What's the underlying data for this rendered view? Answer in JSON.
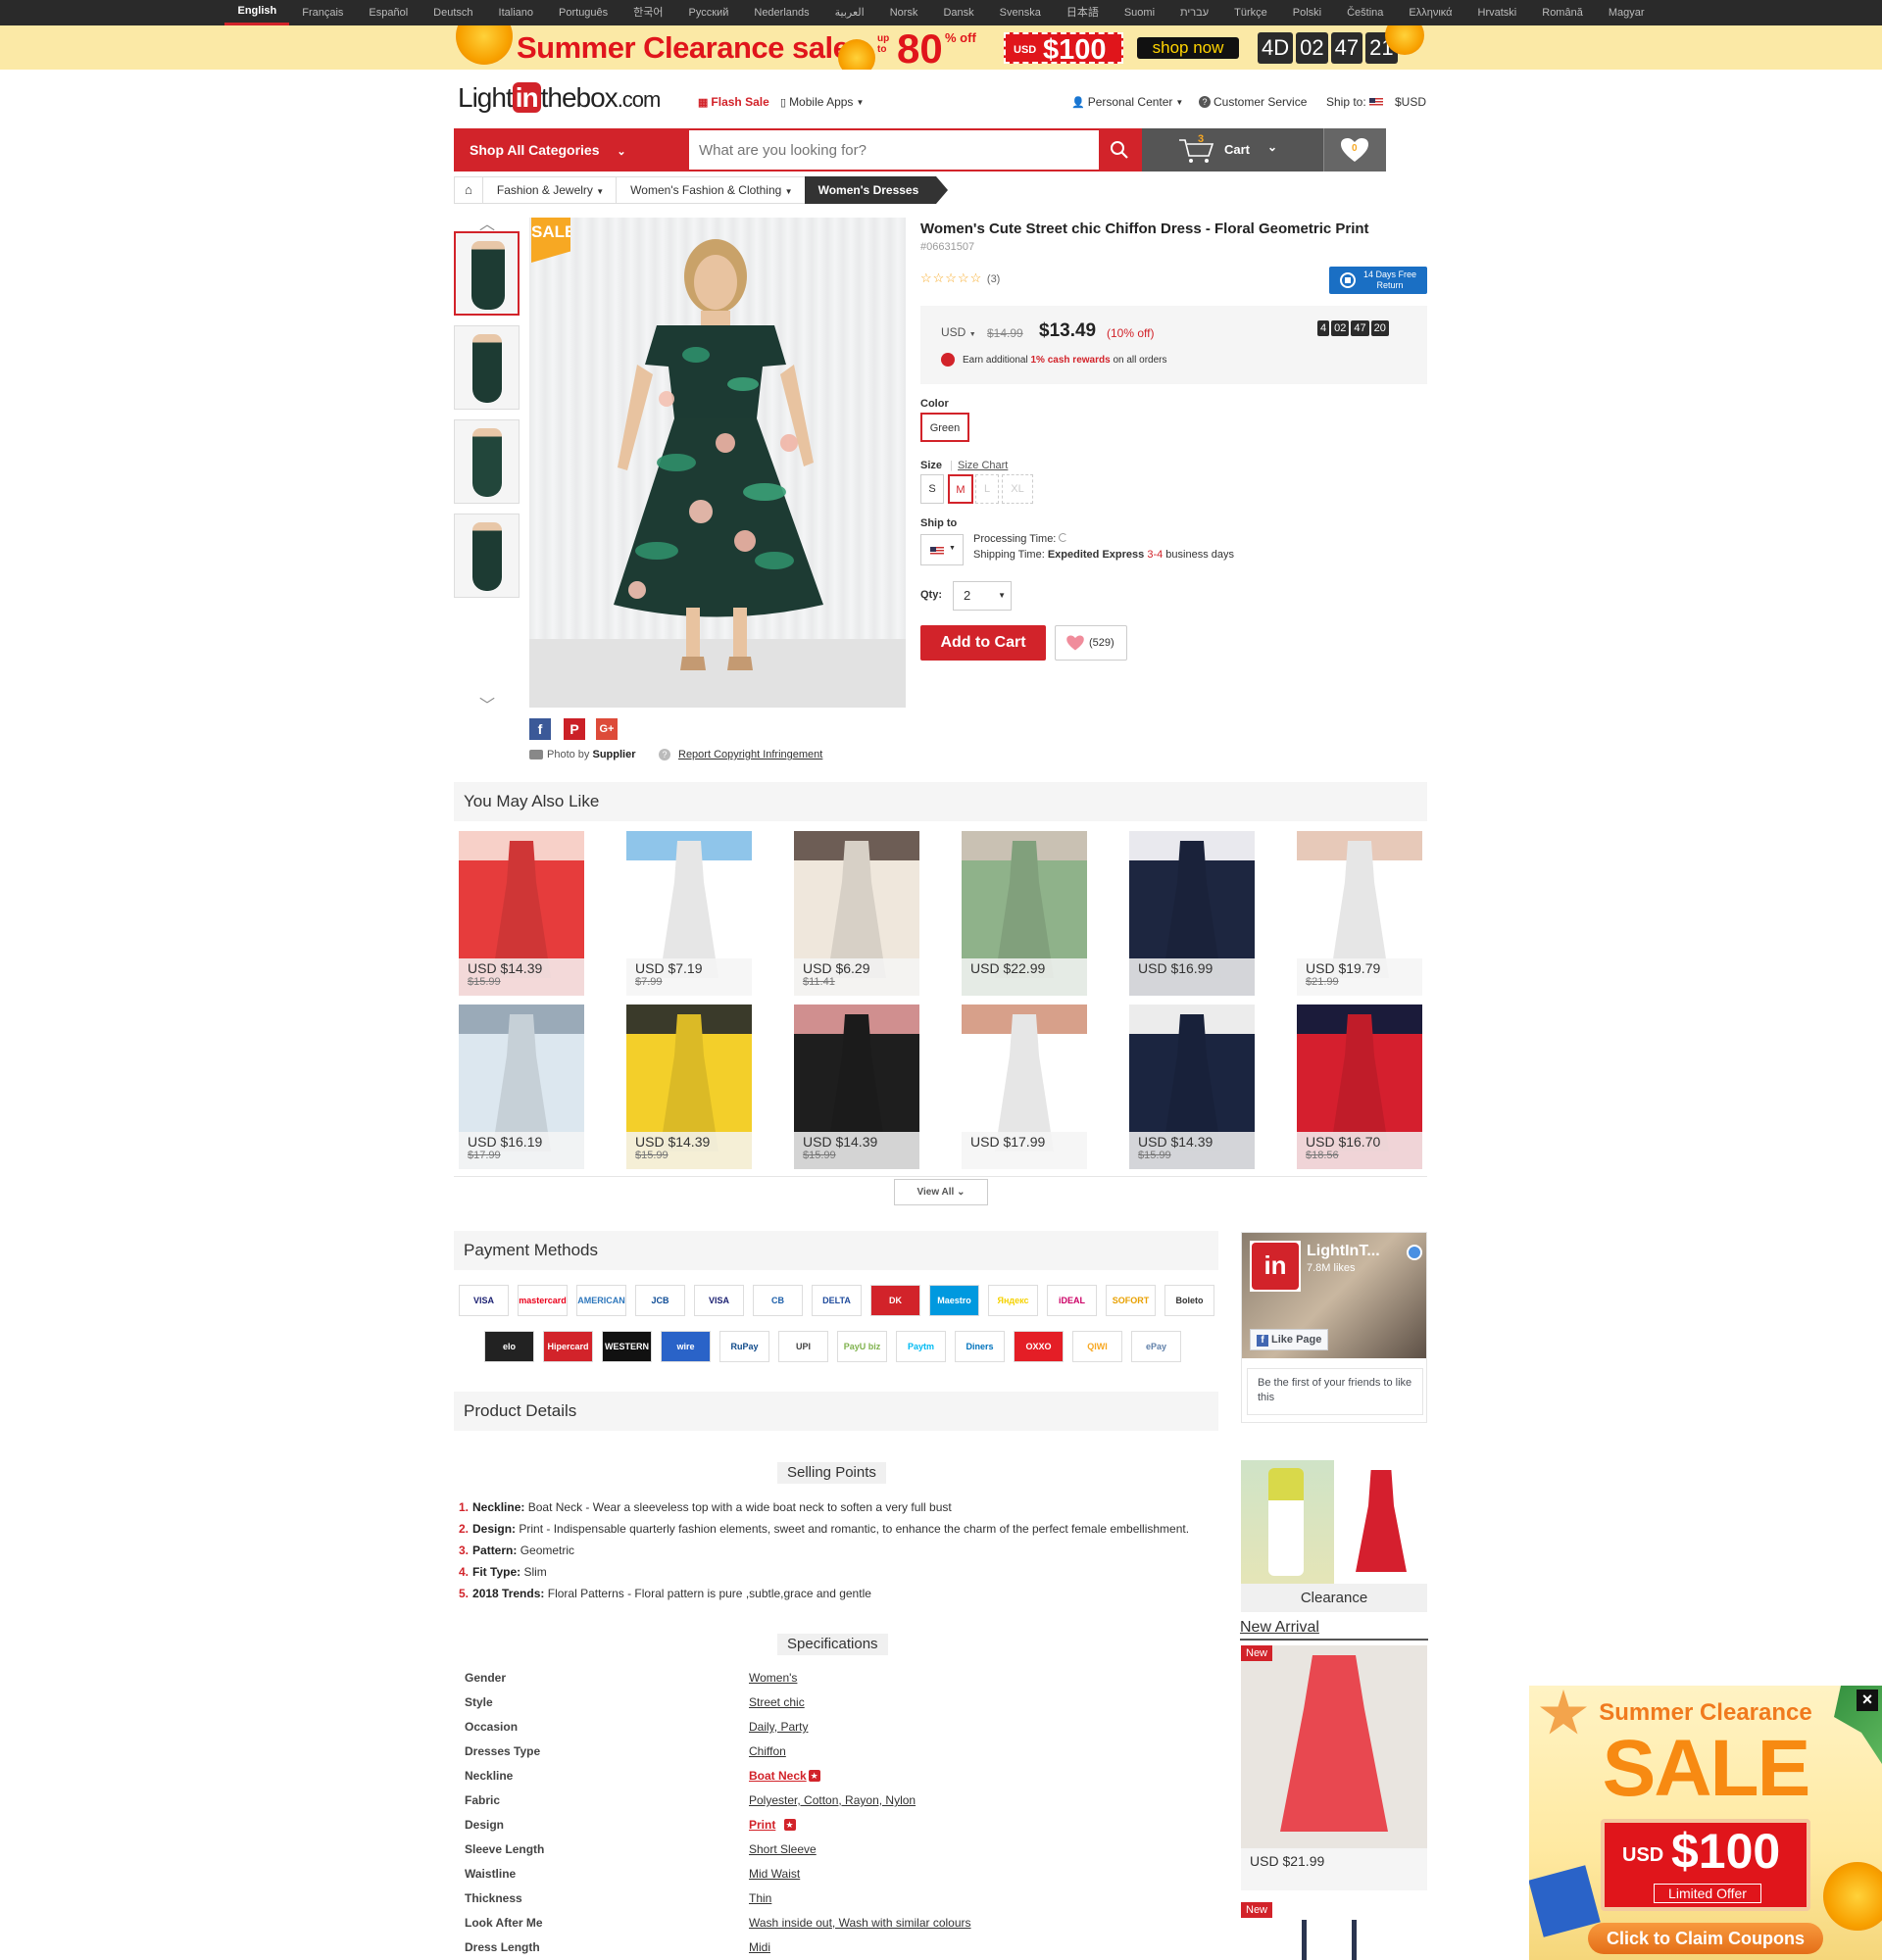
{
  "languages": [
    "English",
    "Français",
    "Español",
    "Deutsch",
    "Italiano",
    "Português",
    "한국어",
    "Русский",
    "Nederlands",
    "العربية",
    "Norsk",
    "Dansk",
    "Svenska",
    "日本語",
    "Suomi",
    "עברית",
    "Türkçe",
    "Polski",
    "Čeština",
    "Ελληνικά",
    "Hrvatski",
    "Română",
    "Magyar"
  ],
  "promo": {
    "title": "Summer Clearance sale",
    "upto": "up to",
    "percent": "80",
    "off": "% off",
    "currency": "USD",
    "amount": "$100",
    "shop_now": "shop now",
    "timer": [
      "4D",
      "02",
      "47",
      "21"
    ]
  },
  "header": {
    "logo_light": "Light",
    "logo_in": "in",
    "logo_the": "thebox",
    "logo_com": ".com",
    "flash_sale": "Flash Sale",
    "mobile_apps": "Mobile Apps",
    "personal_center": "Personal Center",
    "customer_service": "Customer Service",
    "ship_to": "Ship to:",
    "currency": "$USD"
  },
  "nav": {
    "shop_all": "Shop All Categories",
    "search_placeholder": "What are you looking for?",
    "cart_label": "Cart",
    "cart_count": "3",
    "wish_count": "0"
  },
  "breadcrumb": [
    "Fashion & Jewelry",
    "Women's Fashion & Clothing",
    "Women's Dresses"
  ],
  "product": {
    "sale_tag": "SALE",
    "name": "Women's Cute Street chic Chiffon Dress - Floral Geometric Print",
    "id": "#06631507",
    "review_count": "(3)",
    "rating": 5,
    "free_return": "14 Days Free Return",
    "currency": "USD",
    "old_price": "$14.99",
    "price": "$13.49",
    "discount": "10% off",
    "timer": [
      "4",
      "02",
      "47",
      "20"
    ],
    "cash_note_pre": "Earn additional ",
    "cash_note_red": "1% cash rewards",
    "cash_note_post": " on all orders",
    "color_label": "Color",
    "color_value": "Green",
    "size_label": "Size",
    "size_chart": "Size Chart",
    "sizes": [
      "S",
      "M",
      "L",
      "XL"
    ],
    "ship_label": "Ship to",
    "processing": "Processing Time:",
    "shipping_pre": "Shipping Time: ",
    "shipping_method": "Expedited Express",
    "shipping_days": "3-4",
    "shipping_post": " business days",
    "qty_label": "Qty:",
    "qty": "2",
    "add_to_cart": "Add to Cart",
    "wish_count": "(529)",
    "photo_by": "Photo by ",
    "supplier": "Supplier",
    "report": "Report Copyright Infringement"
  },
  "recommend": {
    "title": "You May Also Like",
    "view_all": "View All",
    "items": [
      {
        "price": "USD $14.39",
        "was": "$15.99",
        "colors": [
          "#e63c3c",
          "#f7d0c8"
        ]
      },
      {
        "price": "USD $7.19",
        "was": "$7.99",
        "colors": [
          "#ffffff",
          "#8fc5ea"
        ]
      },
      {
        "price": "USD $6.29",
        "was": "$11.41",
        "colors": [
          "#efe7dc",
          "#6d5d55"
        ]
      },
      {
        "price": "USD $22.99",
        "was": "",
        "colors": [
          "#8fb28a",
          "#c9c1b3"
        ]
      },
      {
        "price": "USD $16.99",
        "was": "",
        "colors": [
          "#1d2640",
          "#e9e9ee"
        ]
      },
      {
        "price": "USD $19.79",
        "was": "$21.99",
        "colors": [
          "#ffffff",
          "#e7c9b9"
        ]
      },
      {
        "price": "USD $16.19",
        "was": "$17.99",
        "colors": [
          "#dce7ef",
          "#9aaab8"
        ]
      },
      {
        "price": "USD $14.39",
        "was": "$15.99",
        "colors": [
          "#f3cf2a",
          "#3a3a2a"
        ]
      },
      {
        "price": "USD $14.39",
        "was": "$15.99",
        "colors": [
          "#1e1e1e",
          "#d08f8f"
        ]
      },
      {
        "price": "USD $17.99",
        "was": "",
        "colors": [
          "#ffffff",
          "#d7a08a"
        ]
      },
      {
        "price": "USD $14.39",
        "was": "$15.99",
        "colors": [
          "#1b2540",
          "#ececec"
        ]
      },
      {
        "price": "USD $16.70",
        "was": "$18.56",
        "colors": [
          "#d51f2e",
          "#1b1b3a"
        ]
      }
    ]
  },
  "payment": {
    "title": "Payment Methods",
    "row1": [
      "VISA",
      "mastercard",
      "AMERICAN EXPRESS",
      "JCB",
      "VISA",
      "CB",
      "DELTA",
      "DK",
      "Maestro",
      "Яндекс Деньги",
      "iDEAL",
      "SOFORT",
      "Boleto"
    ],
    "row2": [
      "elo",
      "Hipercard",
      "WESTERN UNION",
      "wire transfer",
      "RuPay",
      "UPI",
      "PayU biz",
      "Paytm",
      "Diners Club",
      "OXXO",
      "QIWI WALLET",
      "ePay"
    ]
  },
  "facebook": {
    "name": "LightInT...",
    "likes": "7.8M likes",
    "like_page": "Like Page",
    "first_friends": "Be the first of your friends to like this"
  },
  "sidebar": {
    "clearance": "Clearance",
    "new_arrival": "New Arrival",
    "new_badge": "New",
    "new_price": "USD $21.99"
  },
  "details": {
    "title": "Product Details",
    "selling_points_title": "Selling Points",
    "selling_points": [
      {
        "k": "Neckline:",
        "v": "Boat Neck - Wear a sleeveless top with a wide boat neck to soften a very full bust"
      },
      {
        "k": "Design:",
        "v": "Print - Indispensable quarterly fashion elements, sweet and romantic, to enhance the charm of the perfect female embellishment."
      },
      {
        "k": "Pattern:",
        "v": "Geometric"
      },
      {
        "k": "Fit Type:",
        "v": "Slim"
      },
      {
        "k": "2018 Trends:",
        "v": "Floral Patterns - Floral pattern is pure ,subtle,grace and gentle"
      }
    ],
    "specs_title": "Specifications",
    "specs": [
      {
        "k": "Gender",
        "v": "Women's",
        "hot": false
      },
      {
        "k": "Style",
        "v": "Street chic",
        "hot": false
      },
      {
        "k": "Occasion",
        "v": "Daily, Party",
        "hot": false
      },
      {
        "k": "Dresses Type",
        "v": "Chiffon",
        "hot": false
      },
      {
        "k": "Neckline",
        "v": "Boat Neck",
        "hot": true
      },
      {
        "k": "Fabric",
        "v": "Polyester, Cotton, Rayon, Nylon",
        "hot": false
      },
      {
        "k": "Design",
        "v": "Print",
        "hot": true
      },
      {
        "k": "Sleeve Length",
        "v": "Short Sleeve",
        "hot": false
      },
      {
        "k": "Waistline",
        "v": "Mid Waist",
        "hot": false
      },
      {
        "k": "Thickness",
        "v": "Thin",
        "hot": false
      },
      {
        "k": "Look After Me",
        "v": "Wash inside out, Wash with similar colours",
        "hot": false
      },
      {
        "k": "Dress Length",
        "v": "Midi",
        "hot": false
      }
    ]
  },
  "popup": {
    "line1": "Summer Clearance",
    "sale": "SALE",
    "currency": "USD",
    "amount": "$100",
    "limited": "Limited Offer",
    "cta": "Click to Claim Coupons"
  },
  "colors": {
    "brand_red": "#d2232a",
    "accent_orange": "#f7a823",
    "fb_blue": "#3b5998"
  }
}
